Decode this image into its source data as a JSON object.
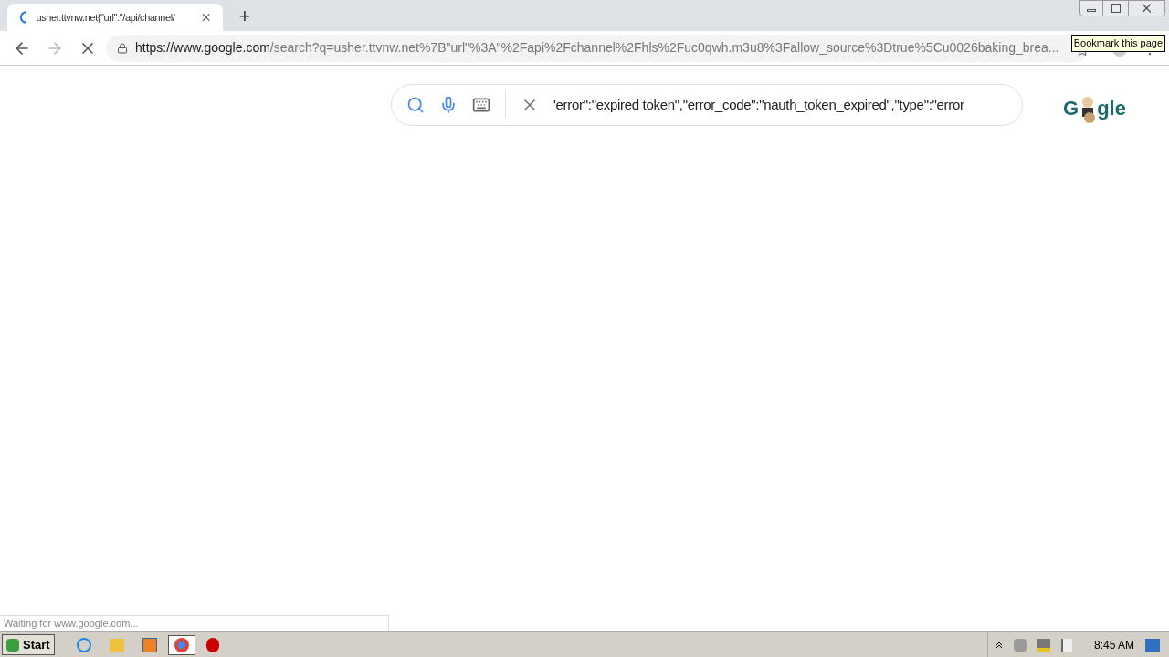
{
  "tab": {
    "title": "usher.ttvnw.net{\"url\":\"/api/channel/",
    "selected": true
  },
  "new_tab": "+",
  "address": {
    "host": "https://www.google.com",
    "path": "/search?q=usher.ttvnw.net%7B\"url\"%3A\"%2Fapi%2Fchannel%2Fhls%2Fuc0qwh.m3u8%3Fallow_source%3Dtrue%5Cu0026baking_brea..."
  },
  "tooltip": "Bookmark this page",
  "search": {
    "value": "'error\":\"expired token\",\"error_code\":\"nauth_token_expired\",\"type\":\"error"
  },
  "logo": {
    "start": "G",
    "end": "gle"
  },
  "status": "Waiting for www.google.com...",
  "taskbar": {
    "start": "Start",
    "clock": "8:45 AM"
  }
}
